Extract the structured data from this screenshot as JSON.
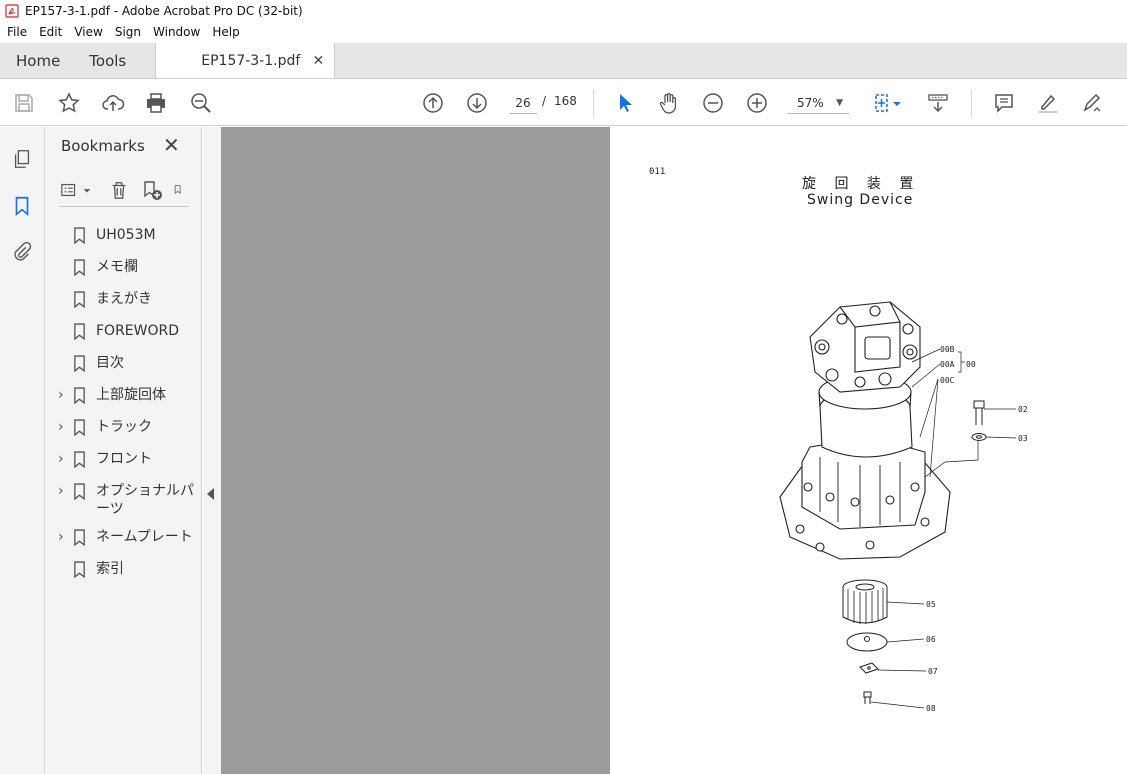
{
  "window": {
    "title": "EP157-3-1.pdf - Adobe Acrobat Pro DC (32-bit)",
    "app_icon": "pdf-app-icon"
  },
  "menu": [
    "File",
    "Edit",
    "View",
    "Sign",
    "Window",
    "Help"
  ],
  "tabs": {
    "home": "Home",
    "tools": "Tools",
    "document": "EP157-3-1.pdf",
    "close_glyph": "✕"
  },
  "toolbar": {
    "current_page": "26",
    "page_separator": "/",
    "total_pages": "168",
    "zoom": "57%"
  },
  "bookmarks": {
    "heading": "Bookmarks",
    "items": [
      {
        "label": "UH053M",
        "expandable": false
      },
      {
        "label": "メモ欄",
        "expandable": false
      },
      {
        "label": "まえがき",
        "expandable": false
      },
      {
        "label": "FOREWORD",
        "expandable": false
      },
      {
        "label": "目次",
        "expandable": false
      },
      {
        "label": "上部旋回体",
        "expandable": true
      },
      {
        "label": "トラック",
        "expandable": true
      },
      {
        "label": "フロント",
        "expandable": true
      },
      {
        "label": "オプショナルパーツ",
        "expandable": true
      },
      {
        "label": "ネームプレート",
        "expandable": true
      },
      {
        "label": "索引",
        "expandable": false
      }
    ]
  },
  "document_page": {
    "page_code": "011",
    "title_jp": "旋 回 装 置",
    "title_en": "Swing Device",
    "part_labels": {
      "p00B": "00B",
      "p00A": "00A",
      "p00": "00",
      "p00C": "00C",
      "p02": "02",
      "p03": "03",
      "p05": "05",
      "p06": "06",
      "p07": "07",
      "p08": "08"
    }
  },
  "colors": {
    "accent_blue": "#1473e6",
    "doc_background": "#9b9b9b",
    "panel_background": "#f4f4f4"
  }
}
